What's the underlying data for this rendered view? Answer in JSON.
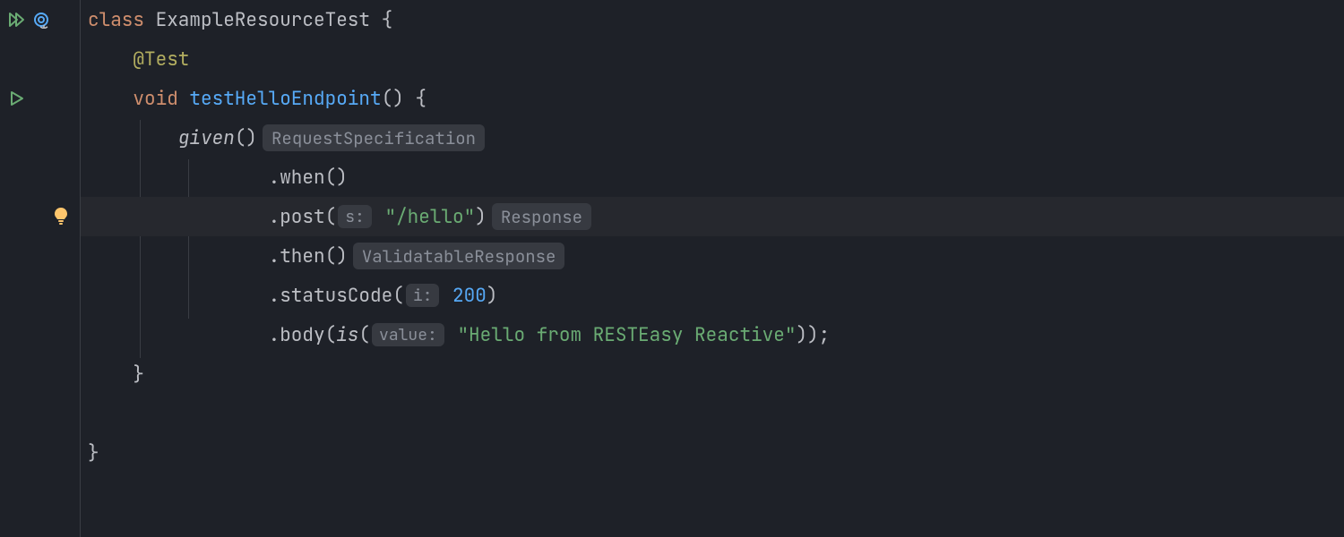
{
  "code": {
    "class_kw": "class",
    "class_name": " ExampleResourceTest ",
    "open_brace": "{",
    "annotation": "@Test",
    "void_kw": "void",
    "method_name": " testHelloEndpoint",
    "method_sig": "() {",
    "given": "given",
    "given_parens": "()",
    "hint_reqspec": "RequestSpecification",
    "when": ".when()",
    "post": ".post(",
    "hint_s": "s:",
    "post_arg": "\"/hello\"",
    "post_close": ")",
    "hint_response": "Response",
    "then": ".then()",
    "hint_validatable": "ValidatableResponse",
    "status": ".statusCode(",
    "hint_i": "i:",
    "status_val": " 200",
    "status_close": ")",
    "body": ".body(",
    "is": "is",
    "is_open": "(",
    "hint_value": "value:",
    "body_str": "\"Hello from RESTEasy Reactive\"",
    "body_close": "));",
    "method_close": "}",
    "class_close": "}"
  },
  "gutter": {
    "run_all": "run-all-icon",
    "target": "target-icon",
    "run": "run-icon",
    "bulb": "bulb-icon"
  },
  "colors": {
    "bg": "#1e2128",
    "highlight": "#26282e",
    "green": "#6aab73",
    "orange": "#cf8e6d",
    "blue": "#57aaf7",
    "yellow": "#ffc66d"
  }
}
